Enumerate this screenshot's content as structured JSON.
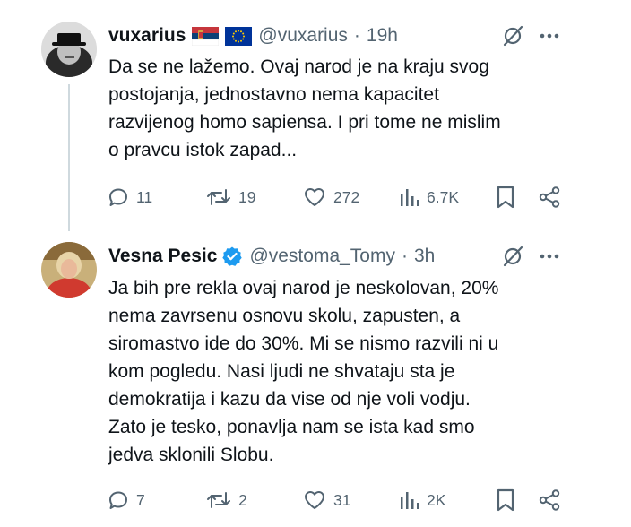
{
  "tweets": [
    {
      "name": "vuxarius",
      "handle": "@vuxarius",
      "separator": "·",
      "time": "19h",
      "text": "Da se ne lažemo. Ovaj narod je na kraju svog\npostojanja, jednostavno nema kapacitet\nrazvijenog homo sapiensa. I pri tome ne mislim\no pravcu istok zapad...",
      "replies": "11",
      "reposts": "19",
      "likes": "272",
      "views": "6.7K"
    },
    {
      "name": "Vesna Pesic",
      "handle": "@vestoma_Tomy",
      "separator": "·",
      "time": "3h",
      "text": "Ja bih pre rekla ovaj narod je neskolovan, 20%\nnema zavrsenu osnovu skolu, zapusten, a\nsiromastvo ide do 30%. Mi se nismo razvili  ni u\nkom pogledu. Nasi ljudi ne shvataju sta je\ndemokratija i kazu da vise od nje voli vodju.\nZato je  tesko, ponavlja nam se ista kad smo\njedva sklonili Slobu.",
      "replies": "7",
      "reposts": "2",
      "likes": "31",
      "views": "2K"
    }
  ],
  "colors": {
    "text": "#0f1419",
    "secondary": "#536471",
    "verified": "#1d9bf0",
    "thread_line": "#cfd9de"
  },
  "icons": [
    "reply-icon",
    "repost-icon",
    "like-icon",
    "views-icon",
    "bookmark-icon",
    "share-icon",
    "grok-icon",
    "more-icon",
    "verified-badge-icon",
    "serbia-flag-icon",
    "eu-flag-icon"
  ]
}
